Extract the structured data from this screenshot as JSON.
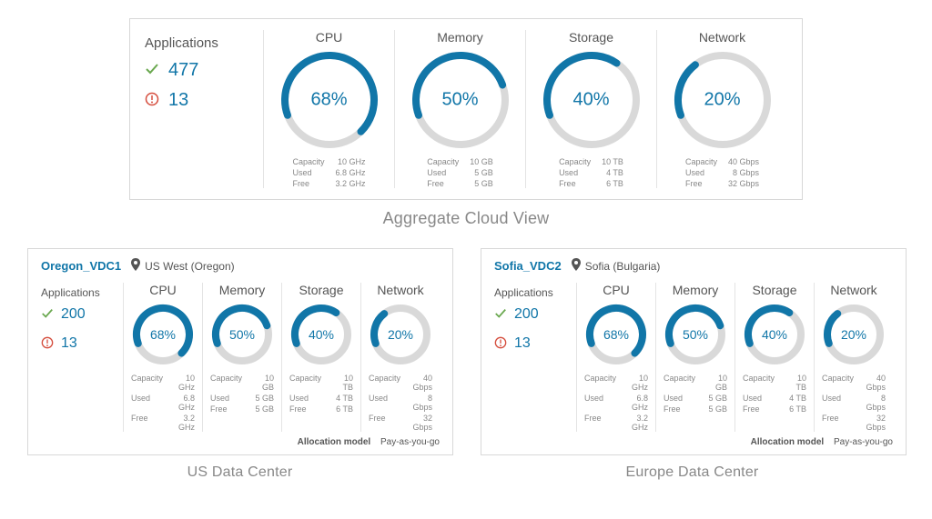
{
  "sections": {
    "aggregate_caption": "Aggregate Cloud View",
    "us_caption": "US Data Center",
    "eu_caption": "Europe Data Center"
  },
  "labels": {
    "applications": "Applications",
    "capacity": "Capacity",
    "used": "Used",
    "free": "Free",
    "allocation_model": "Allocation model"
  },
  "allocation_model_value": "Pay-as-you-go",
  "colors": {
    "accent": "#1176a8",
    "track": "#d9d9d9",
    "ok": "#6aa84f",
    "alert": "#d54d3d"
  },
  "aggregate": {
    "apps_ok": "477",
    "apps_alert": "13",
    "gauges": [
      {
        "title": "CPU",
        "pct": 68,
        "capacity": "10 GHz",
        "used": "6.8 GHz",
        "free": "3.2 GHz"
      },
      {
        "title": "Memory",
        "pct": 50,
        "capacity": "10 GB",
        "used": "5 GB",
        "free": "5 GB"
      },
      {
        "title": "Storage",
        "pct": 40,
        "capacity": "10 TB",
        "used": "4 TB",
        "free": "6 TB"
      },
      {
        "title": "Network",
        "pct": 20,
        "capacity": "40 Gbps",
        "used": "8 Gbps",
        "free": "32 Gbps"
      }
    ]
  },
  "datacenters": [
    {
      "id": "us",
      "link": "Oregon_VDC1",
      "location": "US West (Oregon)",
      "apps_ok": "200",
      "apps_alert": "13",
      "gauges": [
        {
          "title": "CPU",
          "pct": 68,
          "capacity": "10 GHz",
          "used": "6.8 GHz",
          "free": "3.2 GHz"
        },
        {
          "title": "Memory",
          "pct": 50,
          "capacity": "10 GB",
          "used": "5 GB",
          "free": "5 GB"
        },
        {
          "title": "Storage",
          "pct": 40,
          "capacity": "10 TB",
          "used": "4 TB",
          "free": "6 TB"
        },
        {
          "title": "Network",
          "pct": 20,
          "capacity": "40 Gbps",
          "used": "8 Gbps",
          "free": "32 Gbps"
        }
      ]
    },
    {
      "id": "eu",
      "link": "Sofia_VDC2",
      "location": "Sofia (Bulgaria)",
      "apps_ok": "200",
      "apps_alert": "13",
      "gauges": [
        {
          "title": "CPU",
          "pct": 68,
          "capacity": "10 GHz",
          "used": "6.8 GHz",
          "free": "3.2 GHz"
        },
        {
          "title": "Memory",
          "pct": 50,
          "capacity": "10 GB",
          "used": "5 GB",
          "free": "5 GB"
        },
        {
          "title": "Storage",
          "pct": 40,
          "capacity": "10 TB",
          "used": "4 TB",
          "free": "6 TB"
        },
        {
          "title": "Network",
          "pct": 20,
          "capacity": "40 Gbps",
          "used": "8 Gbps",
          "free": "32 Gbps"
        }
      ]
    }
  ],
  "chart_data": {
    "type": "gauge-grid",
    "groups": [
      {
        "name": "Aggregate",
        "metrics": {
          "CPU": 68,
          "Memory": 50,
          "Storage": 40,
          "Network": 20
        }
      },
      {
        "name": "Oregon_VDC1",
        "metrics": {
          "CPU": 68,
          "Memory": 50,
          "Storage": 40,
          "Network": 20
        }
      },
      {
        "name": "Sofia_VDC2",
        "metrics": {
          "CPU": 68,
          "Memory": 50,
          "Storage": 40,
          "Network": 20
        }
      }
    ],
    "unit": "percent",
    "range": [
      0,
      100
    ]
  }
}
